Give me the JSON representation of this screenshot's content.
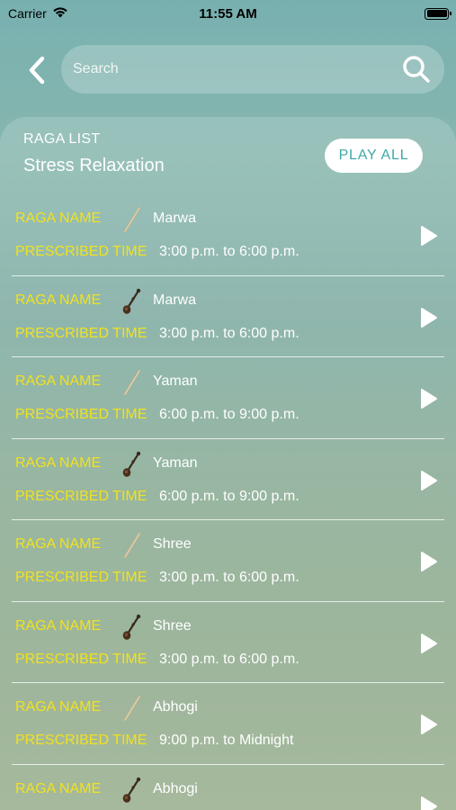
{
  "status_bar": {
    "carrier": "Carrier",
    "time": "11:55 AM"
  },
  "search": {
    "placeholder": "Search"
  },
  "panel": {
    "subtitle": "RAGA LIST",
    "title": "Stress Relaxation",
    "play_all_label": "PLAY ALL"
  },
  "labels": {
    "raga_name": "RAGA NAME",
    "prescribed_time": "PRESCRIBED TIME"
  },
  "ragas": [
    {
      "name": "Marwa",
      "time": "3:00 p.m. to 6:00 p.m.",
      "instrument": "flute-icon"
    },
    {
      "name": "Marwa",
      "time": "3:00 p.m. to 6:00 p.m.",
      "instrument": "sitar-icon"
    },
    {
      "name": "Yaman",
      "time": "6:00 p.m. to 9:00 p.m.",
      "instrument": "flute-icon"
    },
    {
      "name": "Yaman",
      "time": "6:00 p.m. to 9:00 p.m.",
      "instrument": "sitar-icon"
    },
    {
      "name": "Shree",
      "time": "3:00 p.m. to 6:00 p.m.",
      "instrument": "flute-icon"
    },
    {
      "name": "Shree",
      "time": "3:00 p.m. to 6:00 p.m.",
      "instrument": "sitar-icon"
    },
    {
      "name": "Abhogi",
      "time": "9:00 p.m. to Midnight",
      "instrument": "flute-icon"
    },
    {
      "name": "Abhogi",
      "time": "",
      "instrument": "sitar-icon"
    }
  ],
  "colors": {
    "label_yellow": "#f1e21d",
    "accent_teal": "#3fa8a8"
  }
}
